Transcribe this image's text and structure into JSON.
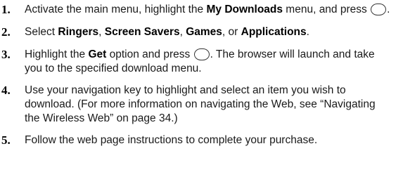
{
  "steps": [
    {
      "num": "1.",
      "t1": "Activate the main menu, highlight the ",
      "b1": "My Downloads",
      "t2": " menu, and press ",
      "t3": ".",
      "key_icon": "center-select-key-icon"
    },
    {
      "num": "2.",
      "t1": "Select ",
      "b1": "Ringers",
      "t2": ", ",
      "b2": "Screen Savers",
      "t3": ", ",
      "b3": "Games",
      "t4": ", or ",
      "b4": "Applications",
      "t5": "."
    },
    {
      "num": "3.",
      "t1": "Highlight the ",
      "b1": "Get",
      "t2": " option and press ",
      "t3": ". The browser will launch and take you to the specified download menu.",
      "key_icon": "center-select-key-icon"
    },
    {
      "num": "4.",
      "text": "Use your navigation key to highlight and select an item you wish to download. (For more information on navigating the Web, see “Navigating the Wireless Web” on page 34.)"
    },
    {
      "num": "5.",
      "text": "Follow the web page instructions to complete your purchase."
    }
  ]
}
